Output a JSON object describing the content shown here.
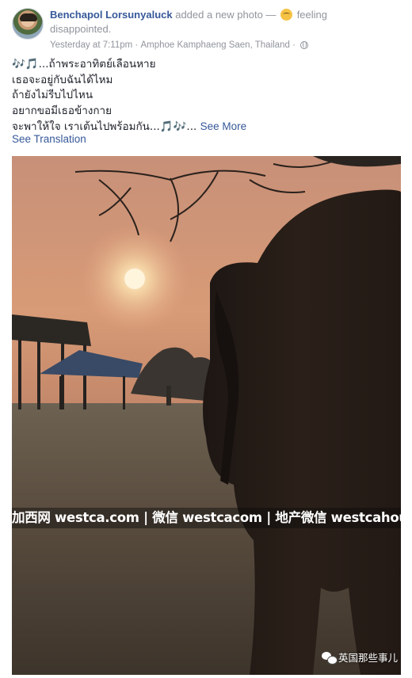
{
  "post": {
    "author": "Benchapol Lorsunyaluck",
    "action": "added a new photo —",
    "feeling_label": "feeling",
    "feeling_value": "disappointed.",
    "timestamp": "Yesterday at 7:11pm",
    "separator": "·",
    "location": "Amphoe Kamphaeng Saen, Thailand",
    "privacy_icon": "globe-icon",
    "feeling_icon": "disappointed-face-icon"
  },
  "caption": {
    "notes_start": "🎶🎵",
    "line1": "...ถ้าพระอาทิตย์เลือนหาย",
    "line2": "เธอจะอยู่กับฉันได้ไหม",
    "line3": "ถ้ายังไม่รีบไปไหน",
    "line4": "อยากขอมีเธอข้างกาย",
    "line5": "จะพาให้ใจ เราเต้นไปพร้อมกัน...",
    "notes_end": "🎵🎶",
    "ellipsis": "...",
    "see_more": "See More",
    "see_translation": "See Translation"
  },
  "photo": {
    "watermark": "加西网 westca.com | 微信 westcacom | 地产微信 westcahouse",
    "badge": "英国那些事儿",
    "badge_icon": "wechat-icon"
  }
}
